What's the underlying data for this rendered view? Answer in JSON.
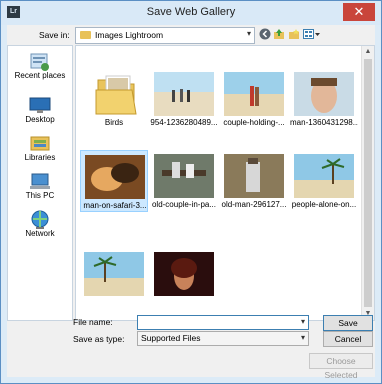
{
  "window": {
    "title": "Save Web Gallery",
    "app_icon": "Lr"
  },
  "toolbar": {
    "save_in_label": "Save in:",
    "save_in_value": "Images Lightroom",
    "icons": [
      "back-icon",
      "up-folder-icon",
      "new-folder-icon",
      "view-menu-icon"
    ]
  },
  "places": [
    {
      "label": "Recent places",
      "icon": "recent-places-icon"
    },
    {
      "label": "Desktop",
      "icon": "desktop-icon"
    },
    {
      "label": "Libraries",
      "icon": "libraries-icon"
    },
    {
      "label": "This PC",
      "icon": "this-pc-icon"
    },
    {
      "label": "Network",
      "icon": "network-icon"
    }
  ],
  "files": [
    {
      "name": "Birds",
      "kind": "folder"
    },
    {
      "name": "954-1236280489...",
      "kind": "image"
    },
    {
      "name": "couple-holding-...",
      "kind": "image"
    },
    {
      "name": "man-1360431298...",
      "kind": "image"
    },
    {
      "name": "man-on-safari-3...",
      "kind": "image",
      "selected": true
    },
    {
      "name": "old-couple-in-pa...",
      "kind": "image"
    },
    {
      "name": "old-man-296127...",
      "kind": "image"
    },
    {
      "name": "people-alone-on...",
      "kind": "image"
    },
    {
      "name": "",
      "kind": "image"
    },
    {
      "name": "",
      "kind": "image"
    }
  ],
  "form": {
    "file_name_label": "File name:",
    "file_name_value": "",
    "save_as_type_label": "Save as type:",
    "save_as_type_value": "Supported Files"
  },
  "buttons": {
    "save": "Save",
    "cancel": "Cancel",
    "choose_selected": "Choose Selected"
  },
  "colors": {
    "accent": "#3c7fb1",
    "close": "#c9453b",
    "selection": "#cce8ff"
  }
}
